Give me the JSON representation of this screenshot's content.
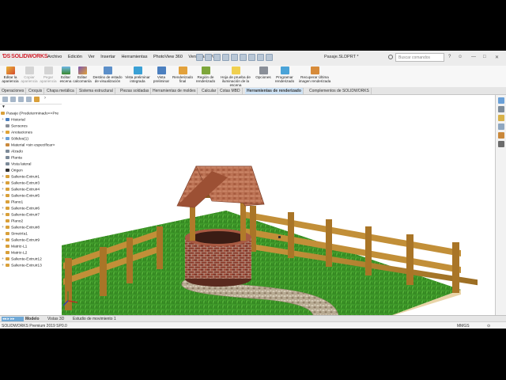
{
  "app": {
    "logo_text": "SOLIDWORKS",
    "document_title": "Pasaje.SLDPRT *",
    "search_placeholder": "Buscar comandos",
    "menu": [
      "Archivo",
      "Edición",
      "Ver",
      "Insertar",
      "Herramientas",
      "PhotoView 360",
      "Ventana"
    ]
  },
  "ribbon": {
    "buttons": [
      {
        "label": [
          "Editar la",
          "apariencia"
        ],
        "enabled": true
      },
      {
        "label": [
          "Copiar",
          "apariencia"
        ],
        "enabled": false
      },
      {
        "label": [
          "Pegar",
          "apariencia"
        ],
        "enabled": false
      },
      {
        "label": [
          "Editar",
          "escena"
        ],
        "enabled": true
      },
      {
        "label": [
          "Editar",
          "calcomanía"
        ],
        "enabled": true
      },
      {
        "label": [
          "Destino de estado",
          "de visualización"
        ],
        "enabled": true
      },
      {
        "label": [
          "Vista preliminar",
          "integrada"
        ],
        "enabled": true
      },
      {
        "label": [
          "Vista",
          "preliminar"
        ],
        "enabled": true
      },
      {
        "label": [
          "Renderizado",
          "final"
        ],
        "enabled": true
      },
      {
        "label": [
          "Región de",
          "renderizado"
        ],
        "enabled": true
      },
      {
        "label": [
          "Hoja de prueba de",
          "iluminación de la escena"
        ],
        "enabled": true
      },
      {
        "label": [
          "Opciones"
        ],
        "enabled": true
      },
      {
        "label": [
          "Programar",
          "renderizado"
        ],
        "enabled": true
      },
      {
        "label": [
          "Recuperar Última",
          "imagen renderizada"
        ],
        "enabled": true
      }
    ]
  },
  "command_tabs": [
    "Operaciones",
    "Croquis",
    "Chapa metálica",
    "Sistema estructural",
    "Piezas soldadas",
    "Herramientas de moldes",
    "Calcular",
    "Cotas MBD",
    "Herramientas de renderizado",
    "Complementos de SOLIDWORKS"
  ],
  "active_tab": "Herramientas de renderizado",
  "feature_tree": {
    "root": "Pasaje (Predeterminado<<Pre",
    "items": [
      {
        "label": "Historial",
        "indent": 1,
        "expand": "+"
      },
      {
        "label": "Sensores",
        "indent": 1,
        "expand": ""
      },
      {
        "label": "Anotaciones",
        "indent": 1,
        "expand": "+"
      },
      {
        "label": "Sólidos(1)",
        "indent": 1,
        "expand": "+"
      },
      {
        "label": "Material <sin especificar>",
        "indent": 1,
        "expand": ""
      },
      {
        "label": "Alzado",
        "indent": 1,
        "expand": ""
      },
      {
        "label": "Planta",
        "indent": 1,
        "expand": ""
      },
      {
        "label": "Vista lateral",
        "indent": 1,
        "expand": ""
      },
      {
        "label": "Origen",
        "indent": 1,
        "expand": ""
      },
      {
        "label": "Saliente-Extruir1",
        "indent": 1,
        "expand": "+"
      },
      {
        "label": "Saliente-Extruir3",
        "indent": 1,
        "expand": "+"
      },
      {
        "label": "Saliente-Extruir4",
        "indent": 1,
        "expand": "+"
      },
      {
        "label": "Saliente-Extruir5",
        "indent": 1,
        "expand": "+"
      },
      {
        "label": "Plano1",
        "indent": 1,
        "expand": ""
      },
      {
        "label": "Saliente-Extruir6",
        "indent": 1,
        "expand": "+"
      },
      {
        "label": "Saliente-Extruir7",
        "indent": 1,
        "expand": "+"
      },
      {
        "label": "Plano2",
        "indent": 1,
        "expand": ""
      },
      {
        "label": "Saliente-Extruir8",
        "indent": 1,
        "expand": "+"
      },
      {
        "label": "Simetría1",
        "indent": 1,
        "expand": ""
      },
      {
        "label": "Saliente-Extruir9",
        "indent": 1,
        "expand": "+"
      },
      {
        "label": "Matriz-L1",
        "indent": 1,
        "expand": ""
      },
      {
        "label": "Matriz-L2",
        "indent": 1,
        "expand": ""
      },
      {
        "label": "Saliente-Extruir12",
        "indent": 1,
        "expand": "+"
      },
      {
        "label": "Saliente-Extruir13",
        "indent": 1,
        "expand": "+"
      }
    ]
  },
  "bottom_tabs": [
    "Modelo",
    "Vistas 3D",
    "Estudio de movimiento 1"
  ],
  "active_bottom_tab": "Modelo",
  "status": {
    "version": "SOLIDWORKS Premium 2019 SP0.0",
    "units": "MMGS"
  },
  "colors": {
    "grass": "#3f9a2a",
    "wood": "#b8862f",
    "roof": "#b46a4c",
    "brick": "#8a3a2a",
    "path": "#b7aa92",
    "accent": "#d21f2b"
  }
}
